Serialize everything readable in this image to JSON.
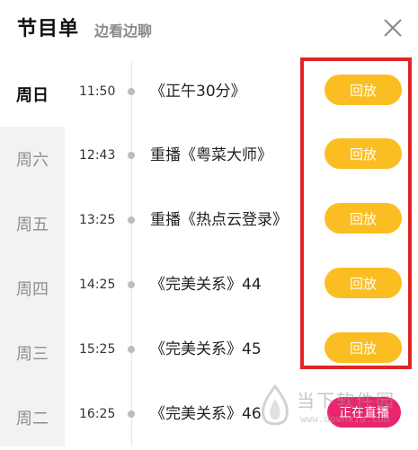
{
  "header": {
    "title": "节目单",
    "subtitle": "边看边聊",
    "close_icon": "close-icon"
  },
  "sidebar": {
    "days": [
      {
        "label": "周日",
        "active": true
      },
      {
        "label": "周六",
        "active": false
      },
      {
        "label": "周五",
        "active": false
      },
      {
        "label": "周四",
        "active": false
      },
      {
        "label": "周三",
        "active": false
      },
      {
        "label": "周二",
        "active": false
      }
    ]
  },
  "schedule": [
    {
      "time": "11:50",
      "program": "《正午30分》",
      "button": "回放"
    },
    {
      "time": "12:43",
      "program": "重播《粤菜大师》",
      "button": "回放"
    },
    {
      "time": "13:25",
      "program": "重播《热点云登录》",
      "button": "回放"
    },
    {
      "time": "14:25",
      "program": "《完美关系》44",
      "button": "回放"
    },
    {
      "time": "15:25",
      "program": "《完美关系》45",
      "button": "回放"
    },
    {
      "time": "16:25",
      "program": "《完美关系》46",
      "button": "正在直播"
    }
  ],
  "watermark": {
    "text": "当下软件园",
    "url": "www.downxia.com"
  },
  "colors": {
    "replay_button": "#fbbe22",
    "live_button": "#e8256e",
    "highlight_border": "#e02424",
    "sidebar_bg": "#f2f2f2"
  }
}
